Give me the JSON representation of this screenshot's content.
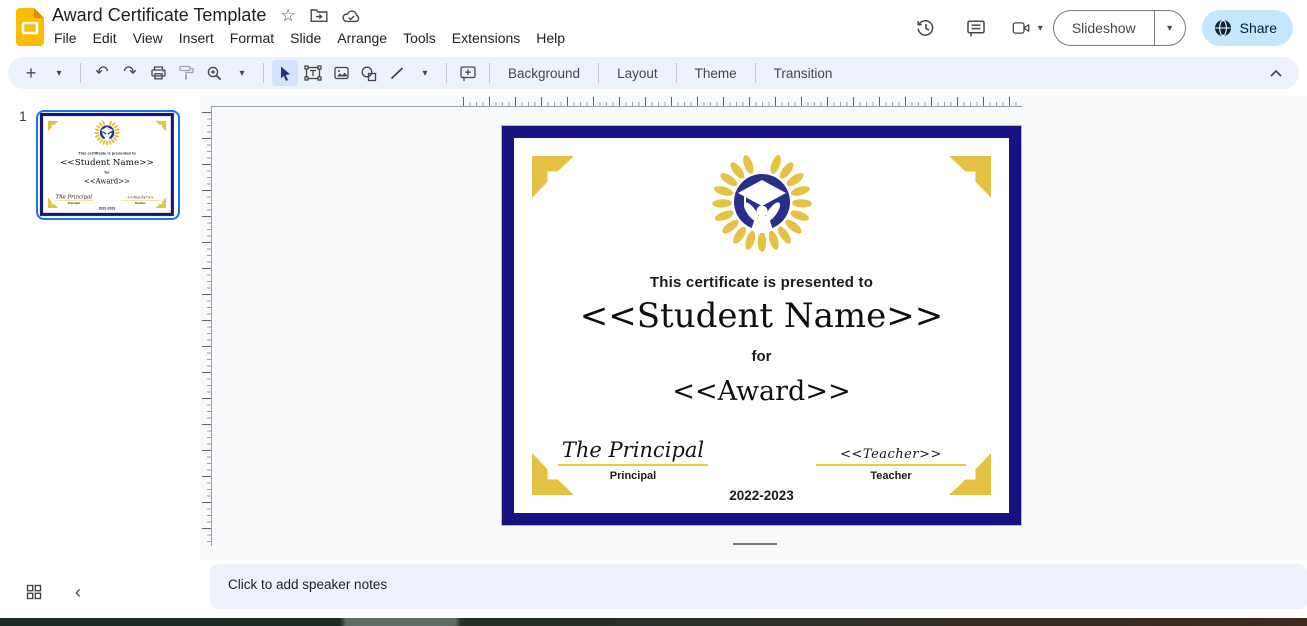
{
  "header": {
    "doc_title": "Award Certificate Template",
    "menu": [
      "File",
      "Edit",
      "View",
      "Insert",
      "Format",
      "Slide",
      "Arrange",
      "Tools",
      "Extensions",
      "Help"
    ],
    "slideshow_label": "Slideshow",
    "share_label": "Share"
  },
  "toolbar": {
    "background_label": "Background",
    "layout_label": "Layout",
    "theme_label": "Theme",
    "transition_label": "Transition"
  },
  "filmstrip": {
    "slide_number": "1"
  },
  "certificate": {
    "presented_text": "This certificate is presented to",
    "student_name": "<<Student Name>>",
    "for_text": "for",
    "award_text": "<<Award>>",
    "principal_signature": "The Principal",
    "principal_label": "Principal",
    "teacher_signature": "<<Teacher>>",
    "teacher_label": "Teacher",
    "year_text": "2022-2023"
  },
  "notes": {
    "placeholder": "Click to add speaker notes"
  },
  "icons": {
    "star": "☆",
    "plus": "+",
    "undo": "↶",
    "redo": "↷",
    "caret_down": "▾",
    "chevron_left": "‹"
  },
  "colors": {
    "navy_border": "#15137f",
    "logo_blue": "#26308c",
    "gold": "#e5c243",
    "selection_blue": "#1a73e8",
    "share_pill": "#c2e7ff",
    "toolbar_pill": "#edf2fa"
  }
}
